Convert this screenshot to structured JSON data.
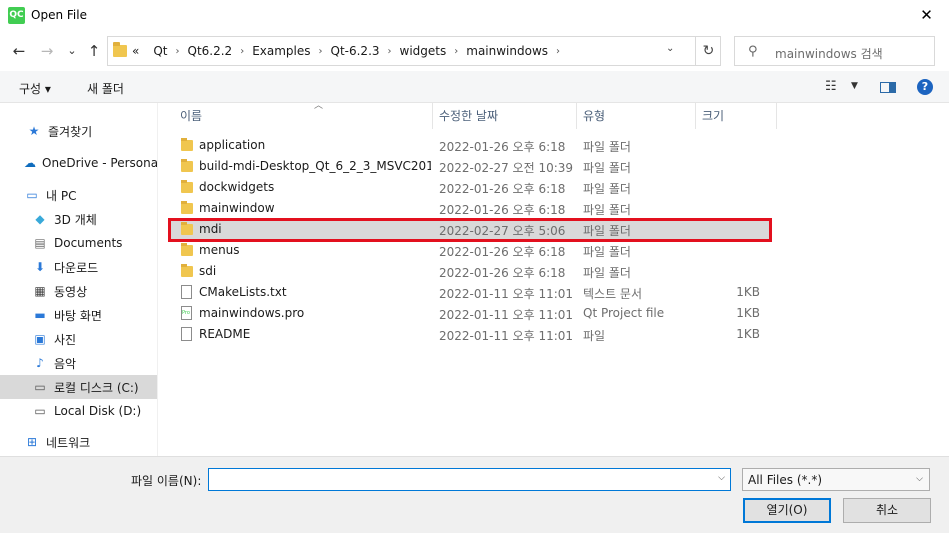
{
  "window": {
    "title": "Open File",
    "app_icon": "QC"
  },
  "nav": {
    "back": "←",
    "forward": "→",
    "recent": "⌄",
    "up": "↑",
    "path": [
      "«",
      "Qt",
      "Qt6.2.2",
      "Examples",
      "Qt-6.2.3",
      "widgets",
      "mainwindows"
    ],
    "search_placeholder": "mainwindows 검색"
  },
  "toolbar": {
    "organize": "구성 ▾",
    "new_folder": "새 폴더"
  },
  "sidebar": {
    "items": [
      {
        "label": "즐겨찾기",
        "icon": "star-icon"
      },
      {
        "label": "OneDrive - Personal",
        "icon": "cloud-icon"
      },
      {
        "label": "내 PC",
        "icon": "pc-icon"
      },
      {
        "label": "3D 개체",
        "icon": "cube-icon"
      },
      {
        "label": "Documents",
        "icon": "document-icon"
      },
      {
        "label": "다운로드",
        "icon": "download-icon"
      },
      {
        "label": "동영상",
        "icon": "video-icon"
      },
      {
        "label": "바탕 화면",
        "icon": "desktop-icon"
      },
      {
        "label": "사진",
        "icon": "picture-icon"
      },
      {
        "label": "음악",
        "icon": "music-icon"
      },
      {
        "label": "로컬 디스크 (C:)",
        "icon": "drive-icon"
      },
      {
        "label": "Local Disk (D:)",
        "icon": "drive-icon"
      },
      {
        "label": "네트워크",
        "icon": "network-icon"
      }
    ]
  },
  "columns": {
    "name": "이름",
    "date": "수정한 날짜",
    "type": "유형",
    "size": "크기"
  },
  "files": [
    {
      "name": "application",
      "date": "2022-01-26 오후 6:18",
      "type": "파일 폴더",
      "size": "",
      "icon": "folder-icon"
    },
    {
      "name": "build-mdi-Desktop_Qt_6_2_3_MSVC201...",
      "date": "2022-02-27 오전 10:39",
      "type": "파일 폴더",
      "size": "",
      "icon": "folder-icon"
    },
    {
      "name": "dockwidgets",
      "date": "2022-01-26 오후 6:18",
      "type": "파일 폴더",
      "size": "",
      "icon": "folder-icon"
    },
    {
      "name": "mainwindow",
      "date": "2022-01-26 오후 6:18",
      "type": "파일 폴더",
      "size": "",
      "icon": "folder-icon"
    },
    {
      "name": "mdi",
      "date": "2022-02-27 오후 5:06",
      "type": "파일 폴더",
      "size": "",
      "icon": "folder-icon"
    },
    {
      "name": "menus",
      "date": "2022-01-26 오후 6:18",
      "type": "파일 폴더",
      "size": "",
      "icon": "folder-icon"
    },
    {
      "name": "sdi",
      "date": "2022-01-26 오후 6:18",
      "type": "파일 폴더",
      "size": "",
      "icon": "folder-icon"
    },
    {
      "name": "CMakeLists.txt",
      "date": "2022-01-11 오후 11:01",
      "type": "텍스트 문서",
      "size": "1KB",
      "icon": "text-file-icon"
    },
    {
      "name": "mainwindows.pro",
      "date": "2022-01-11 오후 11:01",
      "type": "Qt Project file",
      "size": "1KB",
      "icon": "qt-project-icon"
    },
    {
      "name": "README",
      "date": "2022-01-11 오후 11:01",
      "type": "파일",
      "size": "1KB",
      "icon": "file-icon"
    }
  ],
  "bottom": {
    "filename_label": "파일 이름(N):",
    "filename_value": "",
    "filter": "All Files (*.*)",
    "open": "열기(O)",
    "cancel": "취소"
  },
  "colors": {
    "highlight": "#e3101e",
    "accent": "#0078d7"
  }
}
